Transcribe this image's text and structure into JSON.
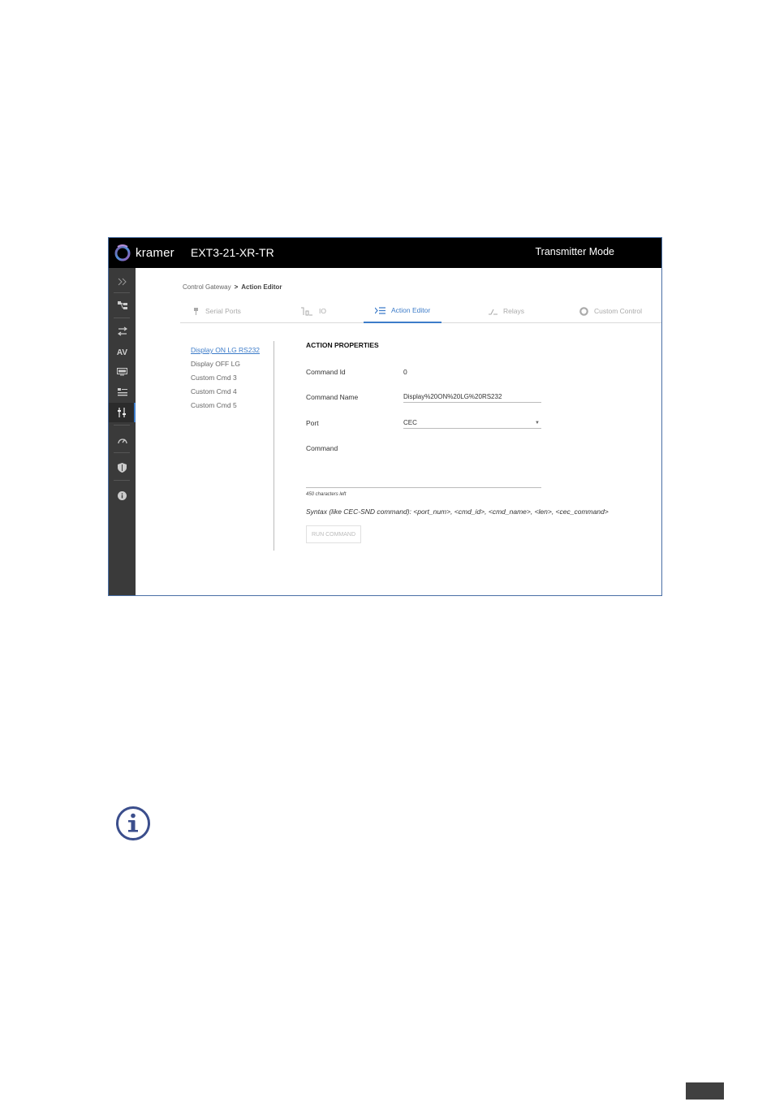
{
  "header": {
    "logo_text": "kramer",
    "device_title": "EXT3-21-XR-TR",
    "mode": "Transmitter Mode"
  },
  "sidebar": {
    "items": [
      {
        "icon": "expand-chevrons-icon",
        "glyph": "»"
      },
      {
        "icon": "network-icon",
        "glyph": ""
      },
      {
        "icon": "switch-icon",
        "glyph": ""
      },
      {
        "icon": "av-icon",
        "glyph": "AV"
      },
      {
        "icon": "display-icon",
        "glyph": ""
      },
      {
        "icon": "settings-list-icon",
        "glyph": ""
      },
      {
        "icon": "control-gateway-icon",
        "glyph": ""
      },
      {
        "icon": "dashboard-icon",
        "glyph": ""
      },
      {
        "icon": "security-shield-icon",
        "glyph": ""
      },
      {
        "icon": "info-icon",
        "glyph": ""
      }
    ]
  },
  "breadcrumb": {
    "parent": "Control Gateway",
    "separator": ">",
    "current": "Action Editor"
  },
  "tabs": [
    {
      "label": "Serial Ports",
      "icon": "serial-port-icon"
    },
    {
      "label": "IO",
      "icon": "io-icon"
    },
    {
      "label": "Action Editor",
      "icon": "action-editor-icon"
    },
    {
      "label": "Relays",
      "icon": "relay-icon"
    },
    {
      "label": "Custom Control",
      "icon": "custom-control-icon"
    }
  ],
  "commands": [
    "Display ON LG RS232",
    "Display OFF LG",
    "Custom Cmd 3",
    "Custom Cmd 4",
    "Custom Cmd 5"
  ],
  "properties": {
    "title": "ACTION PROPERTIES",
    "command_id_label": "Command Id",
    "command_id_value": "0",
    "command_name_label": "Command Name",
    "command_name_value": "Display%20ON%20LG%20RS232",
    "port_label": "Port",
    "port_value": "CEC",
    "command_label": "Command",
    "chars_left": "450 characters left",
    "syntax": "Syntax (like CEC-SND command): <port_num>, <cmd_id>, <cmd_name>, <len>, <cec_command>",
    "run_label": "RUN COMMAND"
  },
  "colors": {
    "accent": "#3d7cc9",
    "topbar": "#000000",
    "sidebar": "#3a3a3a",
    "frame_border": "#4a6fa5"
  }
}
